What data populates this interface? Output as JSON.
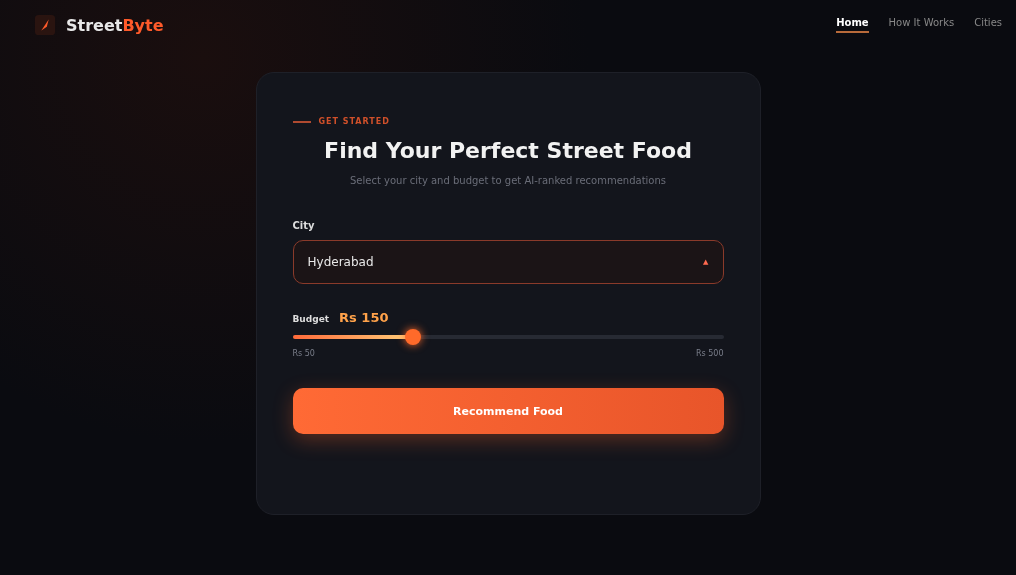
{
  "brand": {
    "name_start": "Street",
    "name_end": "Byte"
  },
  "nav": [
    {
      "label": "Home",
      "selected": true
    },
    {
      "label": "How It Works",
      "selected": false
    },
    {
      "label": "Cities",
      "selected": false
    }
  ],
  "card": {
    "eyebrow": "GET STARTED",
    "title": "Find Your Perfect Street Food",
    "subtitle": "Select your city and budget to get AI-ranked recommendations",
    "city": {
      "label": "City",
      "value": "Hyderabad",
      "caret": "▲"
    },
    "budget": {
      "label": "Budget",
      "reading": "Rs 150",
      "level": 0.28,
      "min_label": "Rs 50",
      "max_label": "Rs 500"
    },
    "button": "Recommend Food"
  }
}
